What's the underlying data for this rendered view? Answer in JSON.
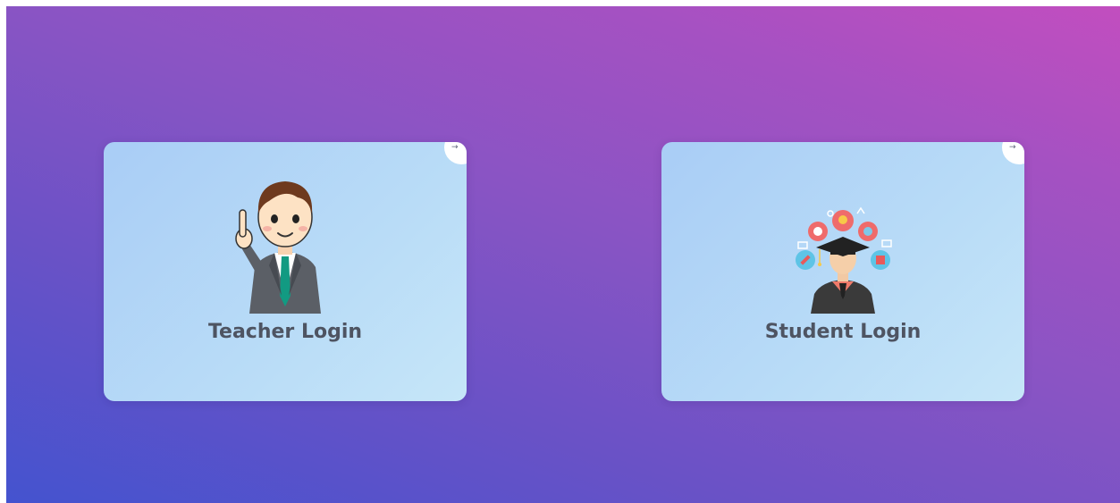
{
  "cards": [
    {
      "label": "Teacher Login",
      "corner_icon": "arrow-right-icon",
      "illustration": "teacher-pointing-icon"
    },
    {
      "label": "Student Login",
      "corner_icon": "arrow-right-icon",
      "illustration": "graduate-student-icon"
    }
  ],
  "arrow_glyph": "→",
  "colors": {
    "bg_start": "#4453cf",
    "bg_end": "#c24ebf",
    "card_bg": "#b4d6f7",
    "label": "#4e5462"
  }
}
